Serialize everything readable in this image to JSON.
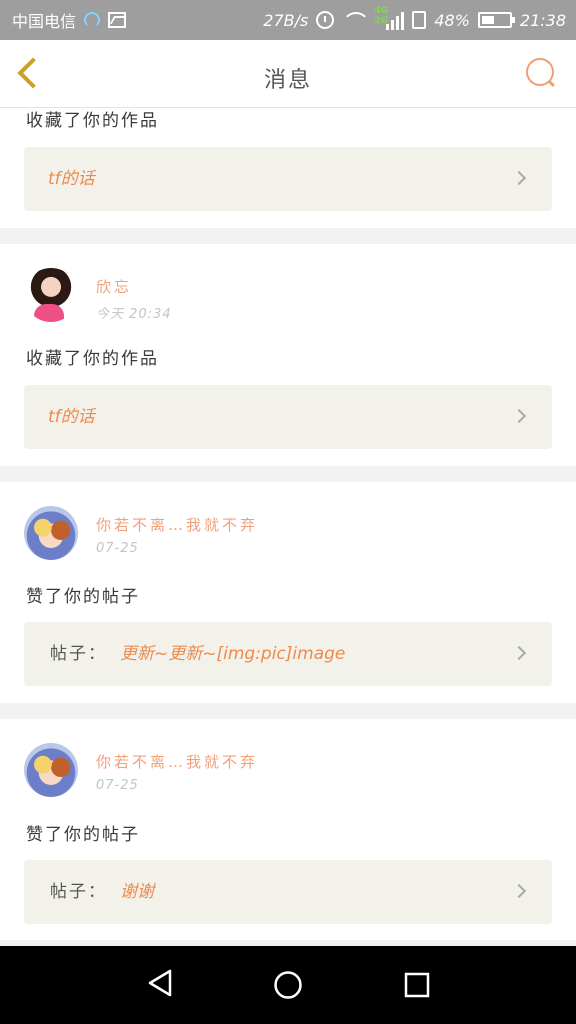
{
  "status_bar": {
    "carrier": "中国电信",
    "speed": "27B/s",
    "network_tags": "4G 2G",
    "battery_percent": "48%",
    "battery_level": 0.48,
    "time": "21:38",
    "icons": [
      "headset-icon",
      "gallery-icon",
      "alarm-icon",
      "wifi-icon",
      "signal-icon",
      "sim-icon",
      "battery-icon"
    ]
  },
  "header": {
    "title": "消息",
    "back_icon": "chevron-left-icon",
    "search_icon": "search-icon",
    "accent_color": "#c9a227"
  },
  "messages": [
    {
      "action": "收藏了你的作品",
      "ref_prefix": "",
      "ref_text": "tf的话"
    },
    {
      "username": "欣忘",
      "time": "今天 20:34",
      "action": "收藏了你的作品",
      "ref_prefix": "",
      "ref_text": "tf的话"
    },
    {
      "username": "你若不离…我就不弃",
      "time": "07-25",
      "action": "赞了你的帖子",
      "ref_prefix": "帖子：",
      "ref_text": "更新~更新~[img:pic]image"
    },
    {
      "username": "你若不离…我就不弃",
      "time": "07-25",
      "action": "赞了你的帖子",
      "ref_prefix": "帖子：",
      "ref_text": "谢谢"
    }
  ],
  "colors": {
    "username": "#f0a07a",
    "reference": "#f08a4b",
    "box_bg": "#f2f1ea",
    "status_bar": "#9e9e9e"
  },
  "nav": {
    "icons": [
      "back-triangle-icon",
      "home-circle-icon",
      "recents-square-icon"
    ]
  }
}
